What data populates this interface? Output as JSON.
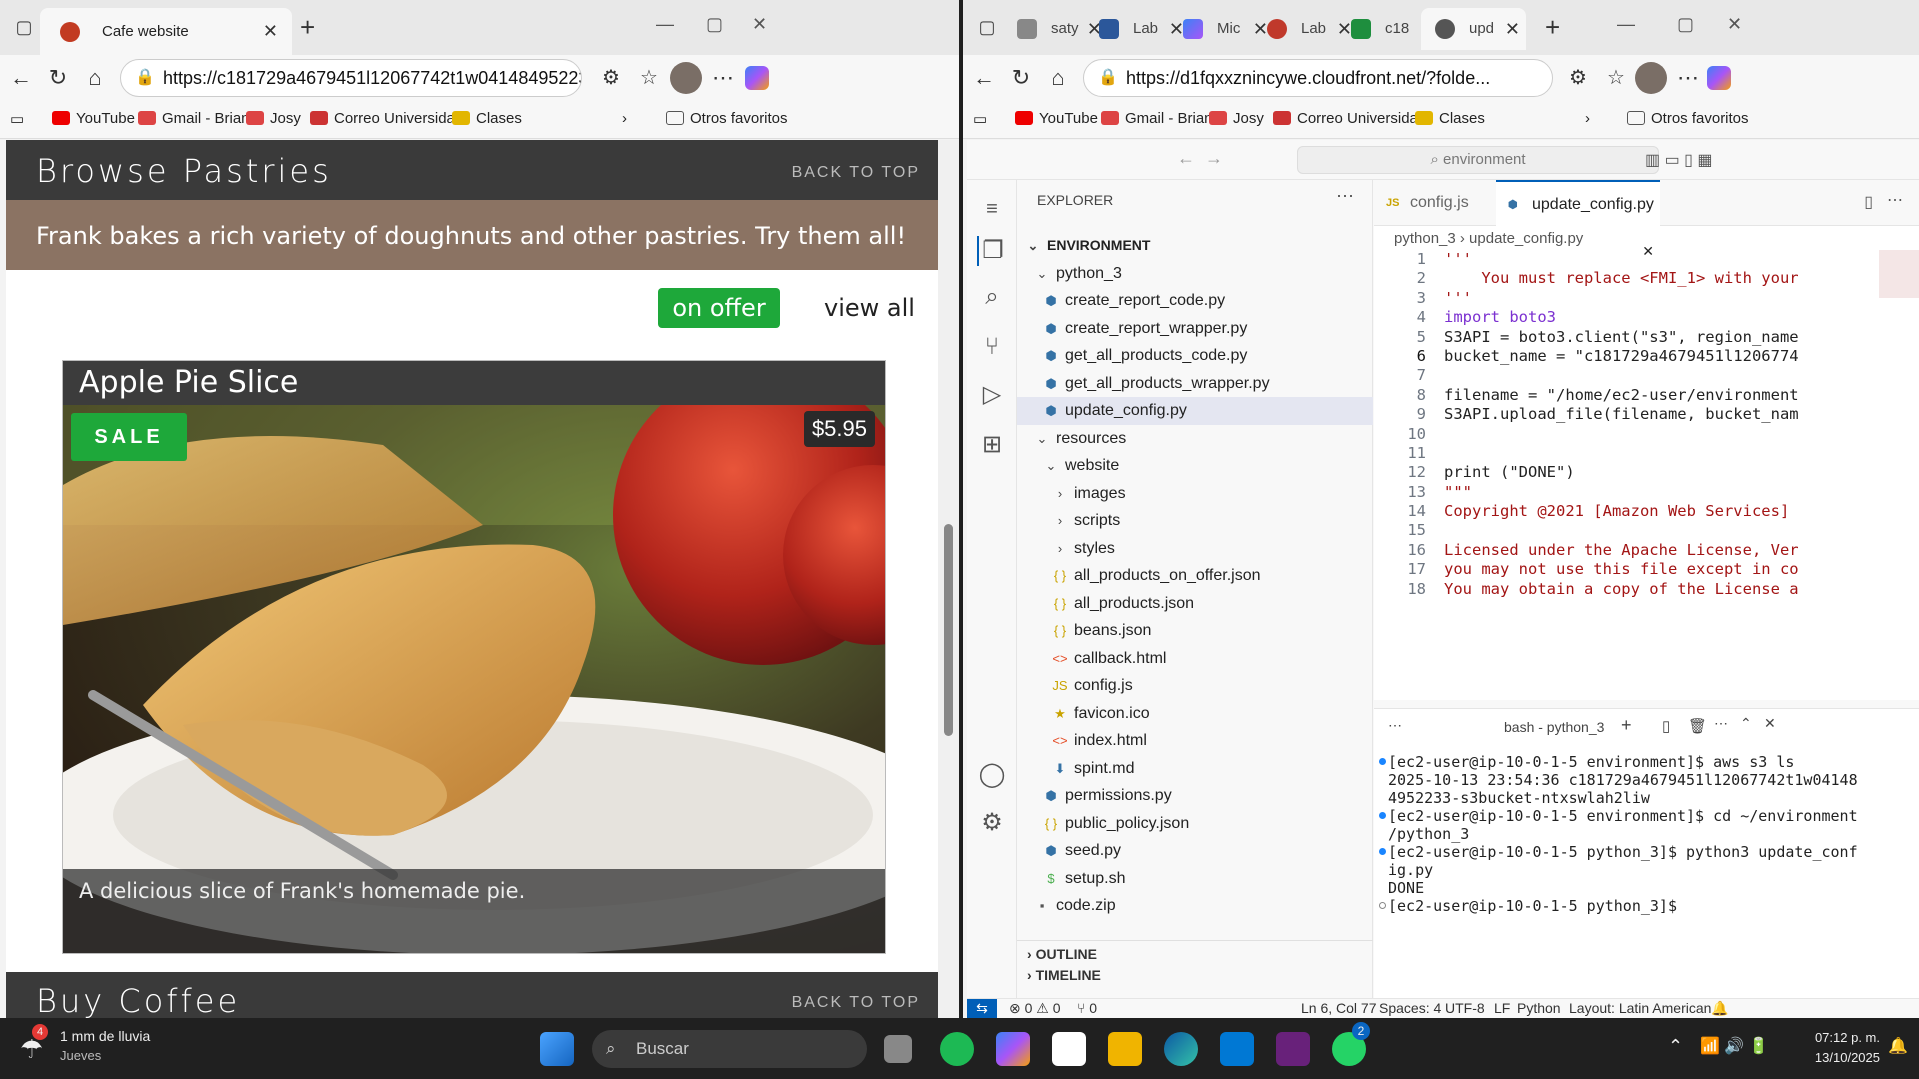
{
  "left_browser": {
    "tab_title": "Cafe website",
    "url": "https://c181729a4679451l12067742t1w04148495223...",
    "bookmarks": [
      "YouTube",
      "Gmail - Brian",
      "Josy",
      "Correo Universidad",
      "Clases"
    ],
    "other_favorites": "Otros favoritos",
    "page": {
      "section_title": "Browse Pastries",
      "back_to_top": "BACK TO TOP",
      "intro": "Frank bakes a rich variety of doughnuts and other pastries. Try them all!",
      "filter_on_offer": "on offer",
      "filter_view_all": "view all",
      "product": {
        "name": "Apple Pie Slice",
        "badge": "SALE",
        "price": "$5.95",
        "caption": "A delicious slice of Frank's homemade pie."
      },
      "next_section": "Buy Coffee",
      "next_back_to_top": "BACK TO TOP"
    }
  },
  "right_browser": {
    "tabs": [
      "saty",
      "Lab",
      "Mic",
      "Lab",
      "c18",
      "upd"
    ],
    "url": "https://d1fqxxznincywe.cloudfront.net/?folde...",
    "bookmarks": [
      "YouTube",
      "Gmail - Brian",
      "Josy",
      "Correo Universidad",
      "Clases"
    ],
    "other_favorites": "Otros favoritos",
    "vscode": {
      "search": "environment",
      "explorer_title": "EXPLORER",
      "tree": [
        {
          "label": "ENVIRONMENT",
          "depth": 0,
          "kind": "root"
        },
        {
          "label": "python_3",
          "depth": 1,
          "kind": "folder-open"
        },
        {
          "label": "create_report_code.py",
          "depth": 2,
          "kind": "py"
        },
        {
          "label": "create_report_wrapper.py",
          "depth": 2,
          "kind": "py"
        },
        {
          "label": "get_all_products_code.py",
          "depth": 2,
          "kind": "py"
        },
        {
          "label": "get_all_products_wrapper.py",
          "depth": 2,
          "kind": "py"
        },
        {
          "label": "update_config.py",
          "depth": 2,
          "kind": "py",
          "selected": true
        },
        {
          "label": "resources",
          "depth": 1,
          "kind": "folder-open"
        },
        {
          "label": "website",
          "depth": 2,
          "kind": "folder-open"
        },
        {
          "label": "images",
          "depth": 3,
          "kind": "folder"
        },
        {
          "label": "scripts",
          "depth": 3,
          "kind": "folder"
        },
        {
          "label": "styles",
          "depth": 3,
          "kind": "folder"
        },
        {
          "label": "all_products_on_offer.json",
          "depth": 3,
          "kind": "json"
        },
        {
          "label": "all_products.json",
          "depth": 3,
          "kind": "json"
        },
        {
          "label": "beans.json",
          "depth": 3,
          "kind": "json"
        },
        {
          "label": "callback.html",
          "depth": 3,
          "kind": "html"
        },
        {
          "label": "config.js",
          "depth": 3,
          "kind": "js"
        },
        {
          "label": "favicon.ico",
          "depth": 3,
          "kind": "star"
        },
        {
          "label": "index.html",
          "depth": 3,
          "kind": "html"
        },
        {
          "label": "spint.md",
          "depth": 3,
          "kind": "md"
        },
        {
          "label": "permissions.py",
          "depth": 2,
          "kind": "py"
        },
        {
          "label": "public_policy.json",
          "depth": 2,
          "kind": "json"
        },
        {
          "label": "seed.py",
          "depth": 2,
          "kind": "py"
        },
        {
          "label": "setup.sh",
          "depth": 2,
          "kind": "sh"
        },
        {
          "label": "code.zip",
          "depth": 1,
          "kind": "zip"
        }
      ],
      "outline": "OUTLINE",
      "timeline": "TIMELINE",
      "editor_tabs": [
        {
          "label": "config.js",
          "active": false
        },
        {
          "label": "update_config.py",
          "active": true
        }
      ],
      "breadcrumb": "python_3 › update_config.py",
      "code_lines": [
        "'''",
        "    You must replace <FMI_1> with your",
        "'''",
        "import boto3",
        "S3API = boto3.client(\"s3\", region_name",
        "bucket_name = \"c181729a4679451l1206774",
        "",
        "filename = \"/home/ec2-user/environment",
        "S3API.upload_file(filename, bucket_nam",
        "",
        "",
        "print (\"DONE\")",
        "\"\"\"",
        "Copyright @2021 [Amazon Web Services]",
        "",
        "Licensed under the Apache License, Ver",
        "you may not use this file except in co",
        "You may obtain a copy of the License a"
      ],
      "terminal_title": "bash - python_3",
      "terminal_lines": [
        "[ec2-user@ip-10-0-1-5 environment]$ aws s3 ls",
        "2025-10-13 23:54:36 c181729a4679451l12067742t1w04148",
        "4952233-s3bucket-ntxswlah2liw",
        "[ec2-user@ip-10-0-1-5 environment]$ cd ~/environment",
        "/python_3",
        "[ec2-user@ip-10-0-1-5 python_3]$ python3 update_conf",
        "ig.py",
        "DONE",
        "[ec2-user@ip-10-0-1-5 python_3]$ "
      ],
      "status": {
        "errors": "0",
        "warnings": "0",
        "ports": "0",
        "position": "Ln 6, Col 77",
        "spaces": "Spaces: 4",
        "encoding": "UTF-8",
        "eol": "LF",
        "language": "Python",
        "layout": "Layout: Latin American"
      }
    }
  },
  "taskbar": {
    "weather_temp": "1 mm de lluvia",
    "weather_day": "Jueves",
    "weather_badge": "4",
    "search": "Buscar",
    "whatsapp_badge": "2",
    "time": "07:12 p. m.",
    "date": "13/10/2025"
  }
}
